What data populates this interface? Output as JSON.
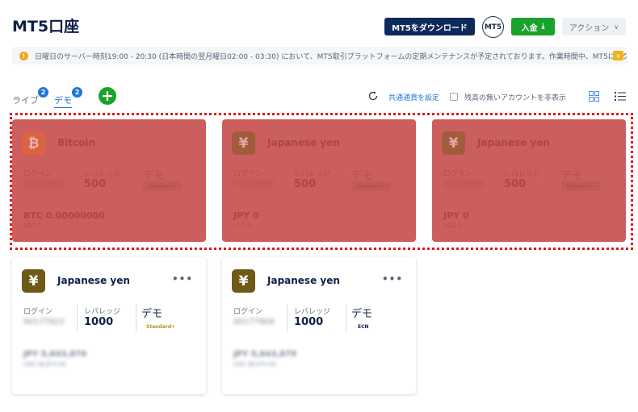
{
  "header": {
    "title": "MT5口座",
    "download_label": "MT5をダウンロード",
    "platform_badge": "MT5",
    "deposit_label": "入金",
    "action_label": "アクション"
  },
  "notice": {
    "text": "日曜日のサーバー時刻19:00 - 20:30 (日本時間の翌月曜日02:00 - 03:30) において、MT5取引プラットフォームの定期メンテナンスが予定されております。作業時間中、MT5にアクセ"
  },
  "tabs": {
    "live_label": "ライブ",
    "live_count": "2",
    "demo_label": "デモ",
    "demo_count": "2"
  },
  "toolbar": {
    "currency_link": "共通通貨を設定",
    "hide_empty_label": "残高の無いアカウントを非表示"
  },
  "labels": {
    "login": "ログイン",
    "leverage": "レバレッジ"
  },
  "colors": {
    "highlight_border": "#e01818",
    "bitcoin_icon": "#e86a2a",
    "yen_icon": "#6e5a16",
    "standard_plus": "#b8921e",
    "accent_green": "#1aa32c",
    "navy": "#0e2a5c"
  },
  "cards": [
    {
      "currency": "Bitcoin",
      "icon": "bitcoin-icon",
      "icon_glyph": "₿",
      "login_value": "00000000",
      "leverage": "500",
      "mode": "デモ",
      "account_type": "Standard+",
      "balance": "BTC 0.00000000",
      "balance_sub": "USD 0",
      "highlighted": true
    },
    {
      "currency": "Japanese yen",
      "icon": "yen-icon",
      "icon_glyph": "¥",
      "login_value": "00000000",
      "leverage": "500",
      "mode": "デモ",
      "account_type": "Standard+",
      "balance": "JPY 0",
      "balance_sub": "USD 0",
      "highlighted": true
    },
    {
      "currency": "Japanese yen",
      "icon": "yen-icon",
      "icon_glyph": "¥",
      "login_value": "00000000",
      "leverage": "500",
      "mode": "デモ",
      "account_type": "Standard+",
      "balance": "JPY 0",
      "balance_sub": "USD 0",
      "highlighted": true
    },
    {
      "currency": "Japanese yen",
      "icon": "yen-icon",
      "icon_glyph": "¥",
      "login_value": "00177922",
      "leverage": "1000",
      "mode": "デモ",
      "account_type": "Standard+",
      "balance": "JPY 5,643,879",
      "balance_sub": "USD 36,875.00",
      "highlighted": false
    },
    {
      "currency": "Japanese yen",
      "icon": "yen-icon",
      "icon_glyph": "¥",
      "login_value": "00177904",
      "leverage": "1000",
      "mode": "デモ",
      "account_type": "ECN",
      "balance": "JPY 5,643,879",
      "balance_sub": "USD 36,875.00",
      "highlighted": false
    }
  ]
}
